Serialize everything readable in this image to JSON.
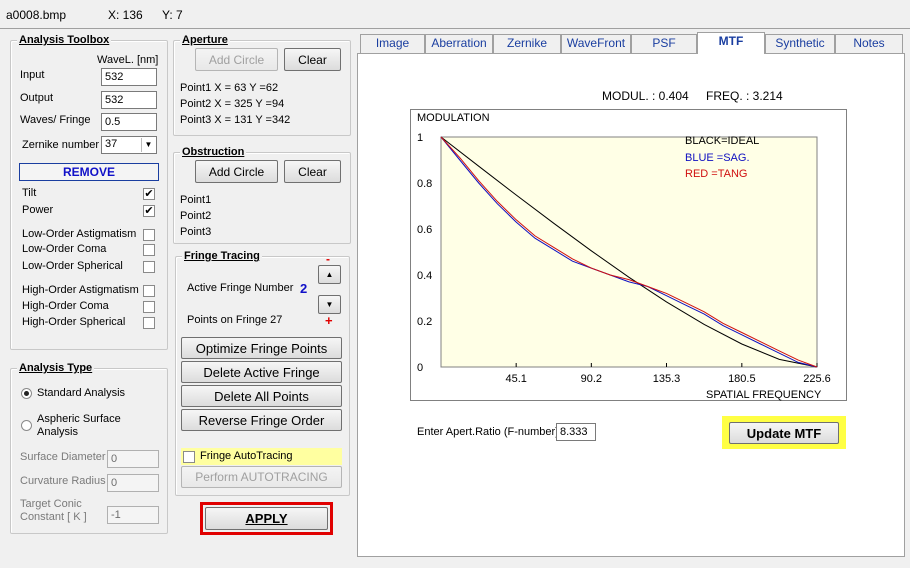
{
  "titlebar": {
    "filename": "a0008.bmp",
    "x_readout": "X: 136",
    "y_readout": "Y: 7"
  },
  "toolbox": {
    "title": "Analysis Toolbox",
    "wavel_header": "WaveL. [nm]",
    "input_label": "Input",
    "input_value": "532",
    "output_label": "Output",
    "output_value": "532",
    "waves_label": "Waves/ Fringe",
    "waves_value": "0.5",
    "zernike_label": "Zernike number",
    "zernike_value": "37",
    "remove_label": "REMOVE",
    "terms": [
      {
        "label": "Tilt",
        "checked": true
      },
      {
        "label": "Power",
        "checked": true
      },
      {
        "label": "Low-Order  Astigmatism",
        "checked": false
      },
      {
        "label": "Low-Order  Coma",
        "checked": false
      },
      {
        "label": "Low-Order  Spherical",
        "checked": false
      },
      {
        "label": "High-Order  Astigmatism",
        "checked": false
      },
      {
        "label": "High-Order  Coma",
        "checked": false
      },
      {
        "label": "High-Order  Spherical",
        "checked": false
      }
    ]
  },
  "analysis_type": {
    "title": "Analysis Type",
    "standard_label": "Standard  Analysis",
    "aspheric_label_1": "Aspheric  Surface",
    "aspheric_label_2": "Analysis",
    "surface_diameter_label": "Surface Diameter",
    "surface_diameter_value": "0",
    "curvature_radius_label": "Curvature Radius",
    "curvature_radius_value": "0",
    "target_conic_label_1": "Target Conic",
    "target_conic_label_2": "Constant [ K ]",
    "target_conic_value": "-1"
  },
  "aperture": {
    "title": "Aperture",
    "add_circle_label": "Add Circle",
    "clear_label": "Clear",
    "points": [
      "Point1 X =   63  Y =62",
      "Point2 X =   325  Y =94",
      "Point3 X =   131  Y =342"
    ]
  },
  "obstruction": {
    "title": "Obstruction",
    "add_circle_label": "Add Circle",
    "clear_label": "Clear",
    "points": [
      "Point1",
      "Point2",
      "Point3"
    ]
  },
  "fringe": {
    "title": "Fringe Tracing",
    "active_label": "Active Fringe Number",
    "active_value": "2",
    "minus_sign": "-",
    "plus_sign": "+",
    "points_label": "Points on  Fringe 27",
    "optimize_label": "Optimize Fringe Points",
    "delete_active_label": "Delete Active Fringe",
    "delete_all_label": "Delete  All  Points",
    "reverse_label": "Reverse  Fringe Order",
    "autotracing_label": "Fringe AutoTracing",
    "perform_label": "Perform  AUTOTRACING"
  },
  "apply_label": "APPLY",
  "tabs": [
    "Image",
    "Aberration",
    "Zernike",
    "WaveFront",
    "PSF",
    "MTF",
    "Synthetic",
    "Notes"
  ],
  "active_tab": "MTF",
  "mtf": {
    "modul_label": "MODUL. :  0.404",
    "freq_label": "FREQ. :  3.214",
    "apert_label": "Enter Apert.Ratio (F-number)",
    "apert_value": "8.333",
    "update_label": "Update MTF"
  },
  "colors": {
    "ideal": "#000000",
    "sag": "#1010c0",
    "tang": "#d01010",
    "plot_bg": "#ffffe6",
    "highlight": "#ffff44",
    "apply_border": "#e00000"
  },
  "chart_data": {
    "type": "line",
    "ylabel": "MODULATION",
    "xlabel": "SPATIAL FREQUENCY",
    "xlim": [
      0,
      225.6
    ],
    "ylim": [
      0,
      1
    ],
    "x_ticks": [
      "45.1",
      "90.2",
      "135.3",
      "180.5",
      "225.6"
    ],
    "x_tick_values": [
      45.1,
      90.2,
      135.3,
      180.5,
      225.6
    ],
    "y_ticks": [
      "0",
      "0.2",
      "0.4",
      "0.6",
      "0.8",
      "1"
    ],
    "y_tick_values": [
      0,
      0.2,
      0.4,
      0.6,
      0.8,
      1
    ],
    "legend": [
      "BLACK=IDEAL",
      "BLUE  =SAG.",
      "RED    =TANG"
    ],
    "series": [
      {
        "name": "BLACK=IDEAL",
        "color": "#000000",
        "x": [
          0,
          22.6,
          45.1,
          67.7,
          90.2,
          112.8,
          135.3,
          157.9,
          180.5,
          203.0,
          225.6
        ],
        "y": [
          1.0,
          0.873,
          0.748,
          0.625,
          0.505,
          0.39,
          0.283,
          0.185,
          0.1,
          0.033,
          0.0
        ]
      },
      {
        "name": "BLUE  =SAG.",
        "color": "#1010c0",
        "x": [
          0,
          11.3,
          22.6,
          33.8,
          45.1,
          56.4,
          67.7,
          78.9,
          90.2,
          101.5,
          112.8,
          124.0,
          135.3,
          146.6,
          157.9,
          169.2,
          180.5,
          191.7,
          203.0,
          214.3,
          225.6
        ],
        "y": [
          1.0,
          0.9,
          0.8,
          0.71,
          0.63,
          0.56,
          0.51,
          0.46,
          0.43,
          0.4,
          0.37,
          0.35,
          0.31,
          0.27,
          0.23,
          0.18,
          0.14,
          0.1,
          0.06,
          0.02,
          0.0
        ]
      },
      {
        "name": "RED    =TANG",
        "color": "#d01010",
        "x": [
          0,
          11.3,
          22.6,
          33.8,
          45.1,
          56.4,
          67.7,
          78.9,
          90.2,
          101.5,
          112.8,
          124.0,
          135.3,
          146.6,
          157.9,
          169.2,
          180.5,
          191.7,
          203.0,
          214.3,
          225.6
        ],
        "y": [
          1.0,
          0.91,
          0.81,
          0.72,
          0.64,
          0.57,
          0.52,
          0.47,
          0.43,
          0.4,
          0.38,
          0.35,
          0.32,
          0.28,
          0.24,
          0.19,
          0.15,
          0.11,
          0.07,
          0.03,
          0.0
        ]
      }
    ]
  }
}
